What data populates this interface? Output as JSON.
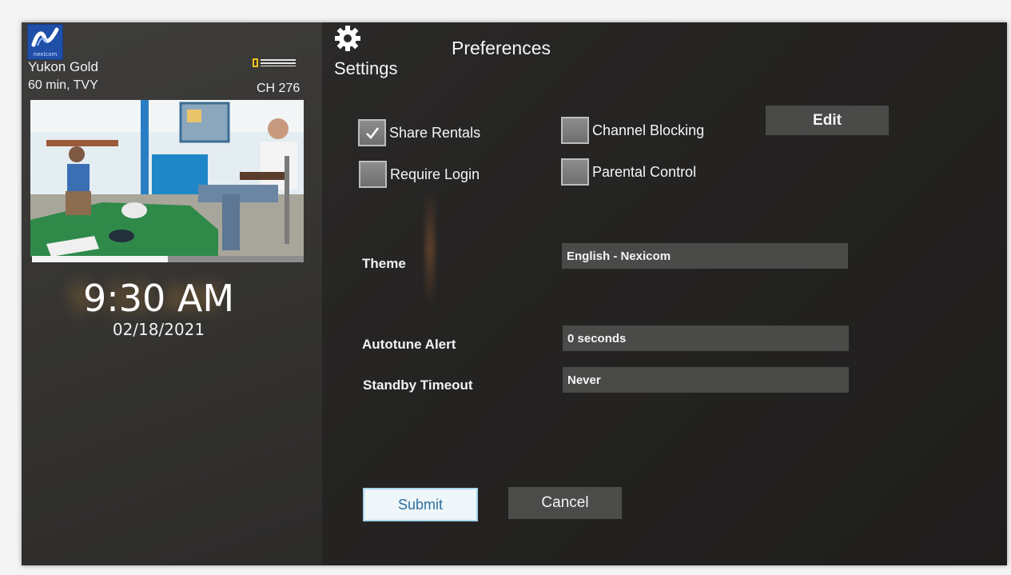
{
  "program": {
    "title": "Yukon Gold",
    "meta": "60 min, TVY",
    "channel": "CH 276",
    "network_logo": "national-geographic-logo",
    "progress_fraction": 0.5
  },
  "clock": {
    "time": "9:30 AM",
    "date": "02/18/2021"
  },
  "header": {
    "settings_label": "Settings",
    "page_title": "Preferences"
  },
  "options": {
    "share_rentals": {
      "label": "Share Rentals",
      "checked": true
    },
    "require_login": {
      "label": "Require Login",
      "checked": false
    },
    "channel_blocking": {
      "label": "Channel Blocking",
      "checked": false
    },
    "parental_control": {
      "label": "Parental Control",
      "checked": false
    },
    "edit_label": "Edit"
  },
  "fields": {
    "theme": {
      "label": "Theme",
      "value": "English - Nexicom"
    },
    "autotune": {
      "label": "Autotune Alert",
      "value": "0 seconds"
    },
    "standby": {
      "label": "Standby Timeout",
      "value": "Never"
    }
  },
  "actions": {
    "submit": "Submit",
    "cancel": "Cancel"
  },
  "colors": {
    "panel": "#353432",
    "background": "#262524",
    "control": "#4a4a49",
    "submit_text": "#2f6f9e",
    "logo_blue": "#1f4fa8"
  }
}
